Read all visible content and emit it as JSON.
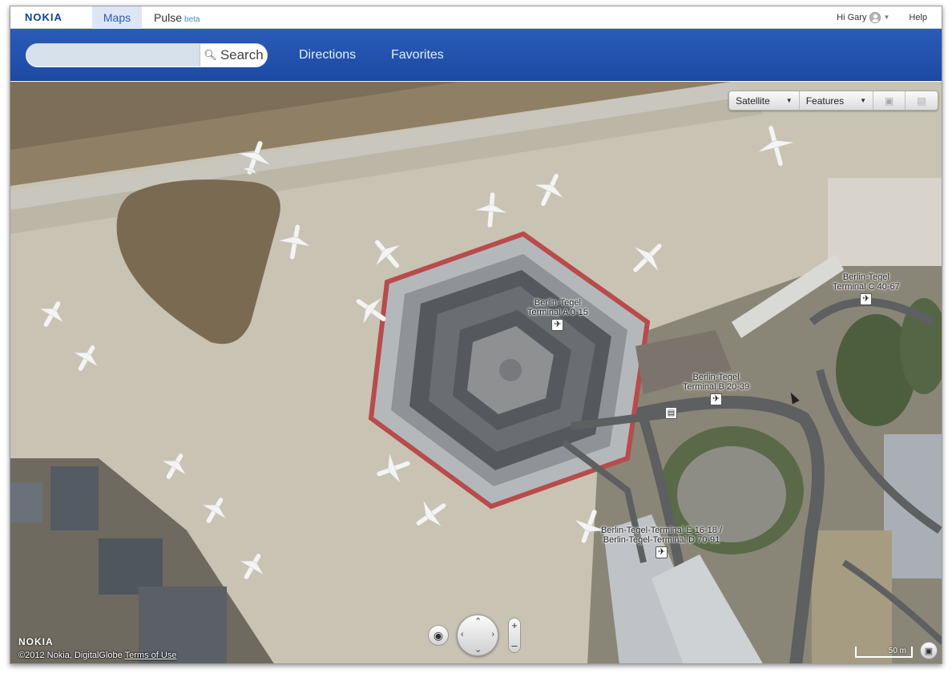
{
  "topbar": {
    "logo": "NOKIA",
    "tabs": {
      "maps": "Maps",
      "pulse": "Pulse",
      "pulse_badge": "beta"
    },
    "greeting": "Hi Gary",
    "help": "Help"
  },
  "header": {
    "search": {
      "value": "",
      "placeholder": "",
      "button": "Search"
    },
    "nav": {
      "directions": "Directions",
      "favorites": "Favorites"
    }
  },
  "map": {
    "controls": {
      "view": "Satellite",
      "features": "Features",
      "traffic_icon": "car-icon",
      "transit_icon": "bus-icon"
    },
    "labels": [
      {
        "lines": [
          "Berlin-Tegel",
          "Terminal A 0-15"
        ],
        "icon": "airplane-icon"
      },
      {
        "lines": [
          "Berlin-Tegel",
          "Terminal B 20-39"
        ],
        "icon": "airplane-icon"
      },
      {
        "lines": [
          "Berlin-Tegel",
          "Terminal C 40-67"
        ],
        "icon": "airplane-icon"
      },
      {
        "lines": [
          "Berlin-Tegel-Terminal E 16-18 /",
          "Berlin-Tegel-Terminal D 70-91"
        ],
        "icon": "airplane-icon"
      }
    ],
    "footer": {
      "logo": "NOKIA",
      "copyright": "©2012 Nokia, DigitalGlobe",
      "terms": "Terms of Use"
    },
    "scale": "50 m"
  }
}
